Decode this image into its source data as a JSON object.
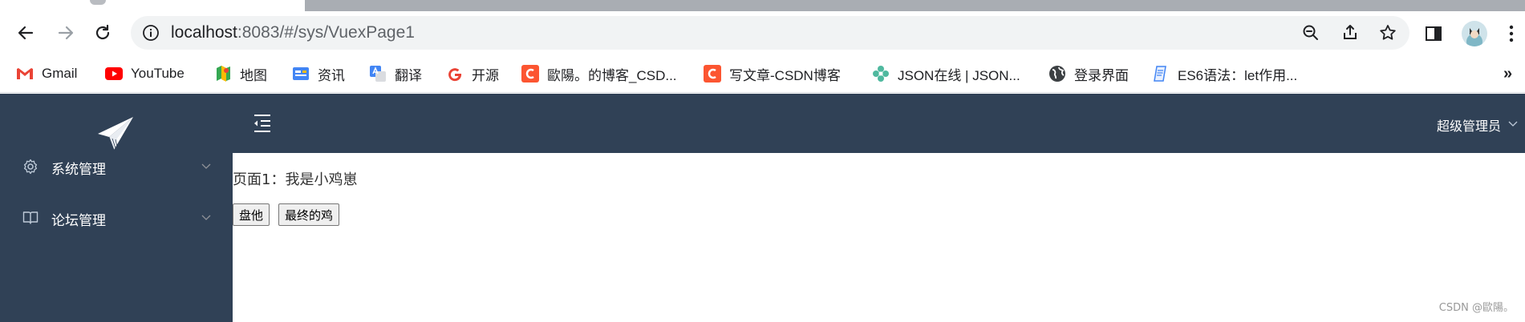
{
  "browser": {
    "url_host": "localhost",
    "url_rest": ":8083/#/sys/VuexPage1",
    "bookmarks": [
      {
        "label": "Gmail",
        "icon": "gmail-icon"
      },
      {
        "label": "YouTube",
        "icon": "youtube-icon"
      },
      {
        "label": "地图",
        "icon": "maps-icon"
      },
      {
        "label": "资讯",
        "icon": "news-icon"
      },
      {
        "label": "翻译",
        "icon": "translate-icon"
      },
      {
        "label": "开源",
        "icon": "google-icon"
      },
      {
        "label": "歐陽。的博客_CSD...",
        "icon": "csdn-icon"
      },
      {
        "label": "写文章-CSDN博客",
        "icon": "csdn-icon"
      },
      {
        "label": "JSON在线 | JSON...",
        "icon": "json-icon"
      },
      {
        "label": "登录界面",
        "icon": "globe-icon"
      },
      {
        "label": "ES6语法：let作用...",
        "icon": "doc-icon"
      }
    ],
    "more_bookmarks": "»"
  },
  "sidebar": {
    "items": [
      {
        "label": "系统管理",
        "icon": "gear-icon"
      },
      {
        "label": "论坛管理",
        "icon": "book-icon"
      }
    ]
  },
  "header": {
    "user_label": "超级管理员"
  },
  "content": {
    "text": "页面1：我是小鸡崽",
    "buttons": [
      "盘他",
      "最终的鸡"
    ]
  },
  "watermark": "CSDN @歐陽。",
  "colors": {
    "sidebar_bg": "#304156",
    "header_bg": "#304156"
  }
}
